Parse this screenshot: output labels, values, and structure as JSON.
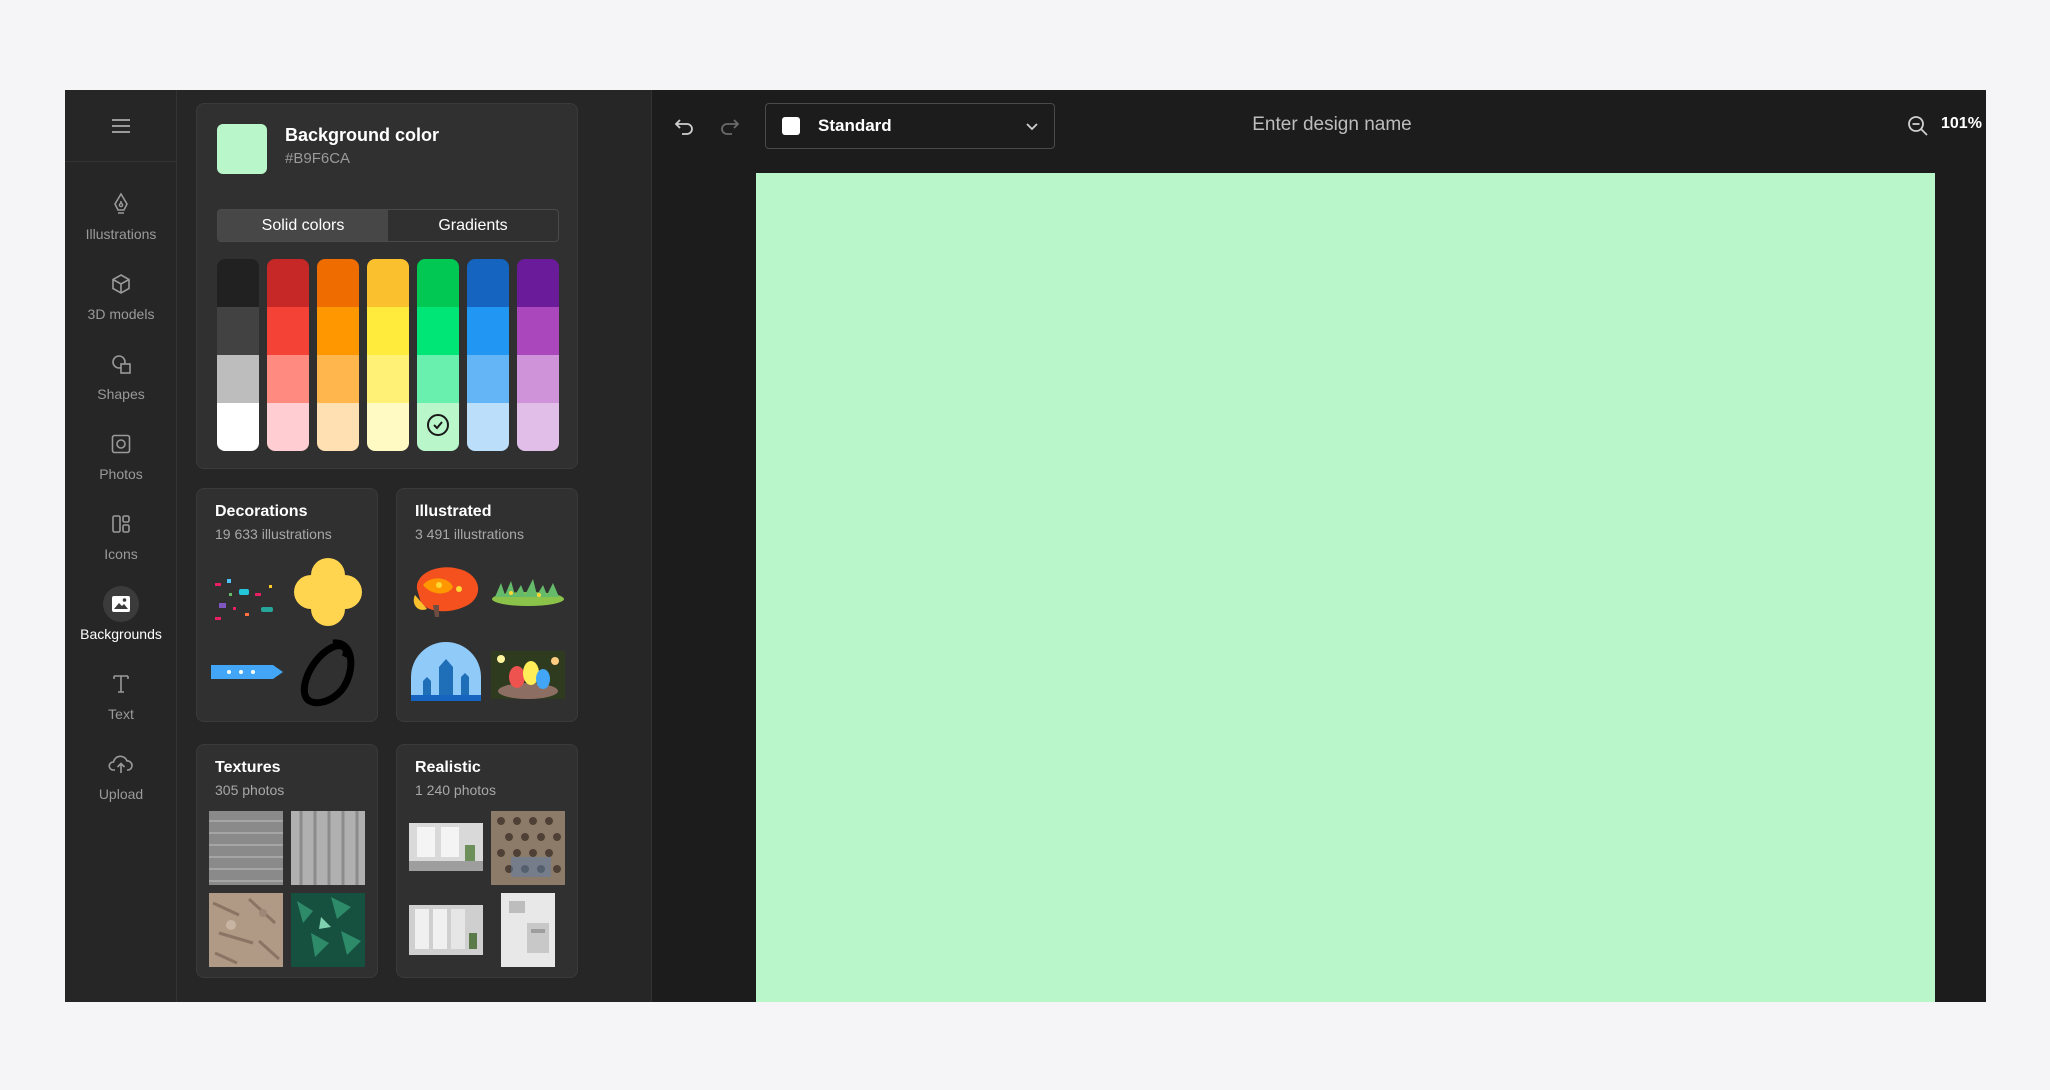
{
  "rail": {
    "items": [
      {
        "label": "Illustrations",
        "icon": "pen-nib-icon"
      },
      {
        "label": "3D models",
        "icon": "cube-icon"
      },
      {
        "label": "Shapes",
        "icon": "shapes-icon"
      },
      {
        "label": "Photos",
        "icon": "photo-icon"
      },
      {
        "label": "Icons",
        "icon": "icons-icon"
      },
      {
        "label": "Backgrounds",
        "icon": "image-icon",
        "active": true
      },
      {
        "label": "Text",
        "icon": "text-icon"
      },
      {
        "label": "Upload",
        "icon": "cloud-upload-icon"
      }
    ]
  },
  "background": {
    "title": "Background color",
    "hex": "#B9F6CA",
    "tabs": {
      "solid": "Solid colors",
      "gradients": "Gradients",
      "active": "solid"
    },
    "palette": [
      [
        "#212121",
        "#424242",
        "#bdbdbd",
        "#ffffff"
      ],
      [
        "#c62828",
        "#f44336",
        "#ff8a80",
        "#ffcdd2"
      ],
      [
        "#ef6c00",
        "#ff9800",
        "#ffb74d",
        "#ffe0b2"
      ],
      [
        "#fbc02d",
        "#ffeb3b",
        "#fff176",
        "#fff9c4"
      ],
      [
        "#00c853",
        "#00e676",
        "#69f0ae",
        "#b9f6ca"
      ],
      [
        "#1565c0",
        "#2196f3",
        "#64b5f6",
        "#bbdefb"
      ],
      [
        "#6a1b9a",
        "#ab47bc",
        "#ce93d8",
        "#e1bee7"
      ]
    ],
    "selected": "#b9f6ca"
  },
  "categories": {
    "decorations": {
      "title": "Decorations",
      "count": "19 633 illustrations"
    },
    "illustrated": {
      "title": "Illustrated",
      "count": "3 491 illustrations"
    },
    "textures": {
      "title": "Textures",
      "count": "305 photos"
    },
    "realistic": {
      "title": "Realistic",
      "count": "1 240 photos"
    }
  },
  "toolbar": {
    "preset": "Standard",
    "design_name_placeholder": "Enter design name",
    "zoom": "101%"
  },
  "canvas": {
    "color": "#B9F6CA"
  }
}
